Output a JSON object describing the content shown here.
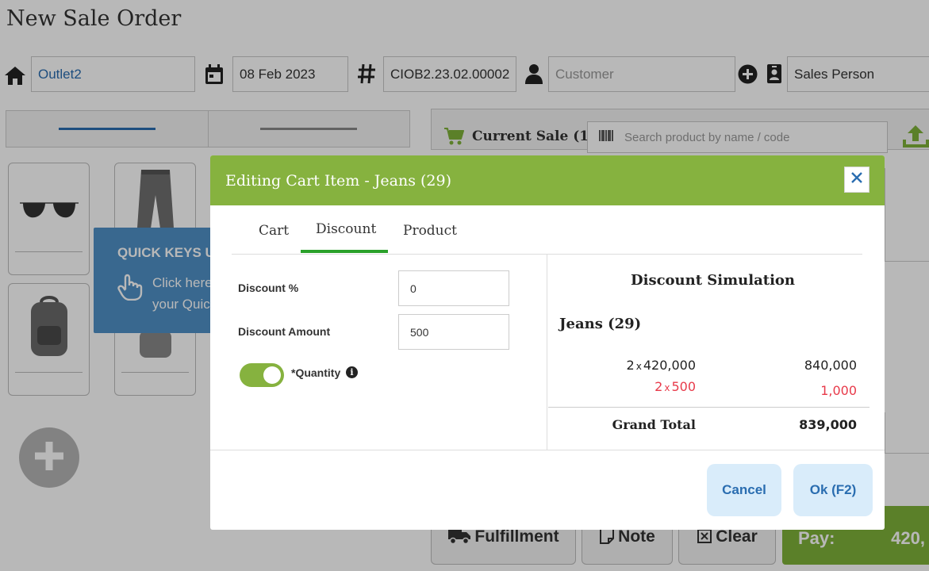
{
  "page": {
    "title": "New Sale Order"
  },
  "header": {
    "outlet": "Outlet2",
    "date": "08 Feb 2023",
    "order_no": "CIOB2.23.02.00002",
    "customer_placeholder": "Customer",
    "sales_person_placeholder": "Sales Person"
  },
  "icons": {
    "home": "home-icon",
    "calendar": "calendar-icon",
    "hash": "hash-icon",
    "person": "person-icon",
    "add": "plus-circle-icon",
    "badge": "badge-icon"
  },
  "quick_keys": {
    "title": "QUICK KEYS U",
    "line1": "Click here",
    "line2": "your Quic"
  },
  "cart": {
    "title": "Current Sale (1)",
    "search_placeholder": "Search product by name / code"
  },
  "bottom": {
    "fulfillment": "Fulfillment",
    "note": "Note",
    "clear": "Clear",
    "pay_label": "Pay:",
    "pay_amount": "420,"
  },
  "modal": {
    "title": "Editing Cart Item - Jeans (29)",
    "tabs": [
      "Cart",
      "Discount",
      "Product"
    ],
    "active_tab": "Discount",
    "form": {
      "discount_pct_label": "Discount %",
      "discount_pct_value": "0",
      "discount_amount_label": "Discount Amount",
      "discount_amount_value": "500",
      "quantity_label": "*Quantity",
      "quantity_enabled": true,
      "info_glyph": "i"
    },
    "simulation": {
      "title": "Discount Simulation",
      "product": "Jeans (29)",
      "qty": "2",
      "multiply": "x",
      "unit_price": "420,000",
      "line_total": "840,000",
      "discount_qty": "2",
      "discount_unit": "500",
      "discount_total": "1,000",
      "grand_total_label": "Grand Total",
      "grand_total": "839,000"
    },
    "buttons": {
      "cancel": "Cancel",
      "ok": "Ok (F2)"
    }
  },
  "colors": {
    "accent_green": "#86b23f",
    "link_blue": "#2a6db0",
    "discount_red": "#e83a4a",
    "button_bg": "#d9ecfa"
  }
}
